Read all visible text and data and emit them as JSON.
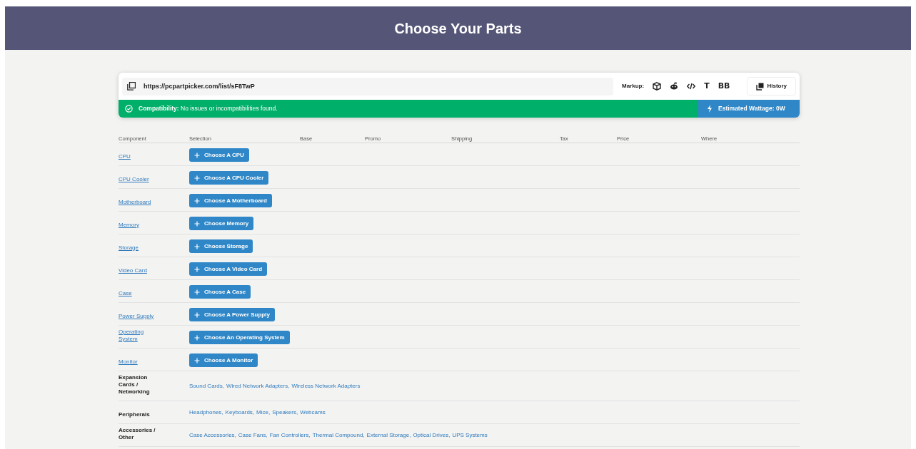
{
  "header": {
    "title": "Choose Your Parts"
  },
  "toolbar": {
    "url": "https://pcpartpicker.com/list/sF8TwP",
    "markup_label": "Markup:",
    "markup_buttons": [
      {
        "kind": "box"
      },
      {
        "kind": "alien"
      },
      {
        "kind": "code"
      },
      {
        "kind": "text",
        "label": "T"
      },
      {
        "kind": "text",
        "label": "BB"
      }
    ],
    "history_button": "History"
  },
  "status": {
    "compatibility_label": "Compatibility:",
    "compatibility_text": "No issues or incompatibilities found.",
    "wattage": "Estimated Wattage: 0W"
  },
  "table": {
    "columns": [
      "Component",
      "Selection",
      "Base",
      "Promo",
      "Shipping",
      "Tax",
      "Price",
      "Where"
    ],
    "rows": [
      {
        "kind": "button",
        "component": "CPU",
        "button": "Choose A CPU"
      },
      {
        "kind": "button",
        "component": "CPU Cooler",
        "button": "Choose A CPU Cooler"
      },
      {
        "kind": "button",
        "component": "Motherboard",
        "button": "Choose A Motherboard"
      },
      {
        "kind": "button",
        "component": "Memory",
        "button": "Choose Memory"
      },
      {
        "kind": "button",
        "component": "Storage",
        "button": "Choose Storage"
      },
      {
        "kind": "button",
        "component": "Video Card",
        "button": "Choose A Video Card"
      },
      {
        "kind": "button",
        "component": "Case",
        "button": "Choose A Case"
      },
      {
        "kind": "button",
        "component": "Power Supply",
        "button": "Choose A Power Supply"
      },
      {
        "kind": "button",
        "component": "Operating System",
        "button": "Choose An Operating System"
      },
      {
        "kind": "button",
        "component": "Monitor",
        "button": "Choose A Monitor"
      },
      {
        "kind": "links",
        "component": "Expansion Cards / Networking",
        "links": [
          "Sound Cards,",
          "Wired Network Adapters,",
          "Wireless Network Adapters"
        ]
      },
      {
        "kind": "links",
        "component": "Peripherals",
        "links": [
          "Headphones,",
          "Keyboards,",
          "Mice,",
          "Speakers,",
          "Webcams"
        ]
      },
      {
        "kind": "links",
        "component": "Accessories / Other",
        "links": [
          "Case Accessories,",
          "Case Fans,",
          "Fan Controllers,",
          "Thermal Compound,",
          "External Storage,",
          "Optical Drives,",
          "UPS Systems"
        ]
      }
    ]
  }
}
